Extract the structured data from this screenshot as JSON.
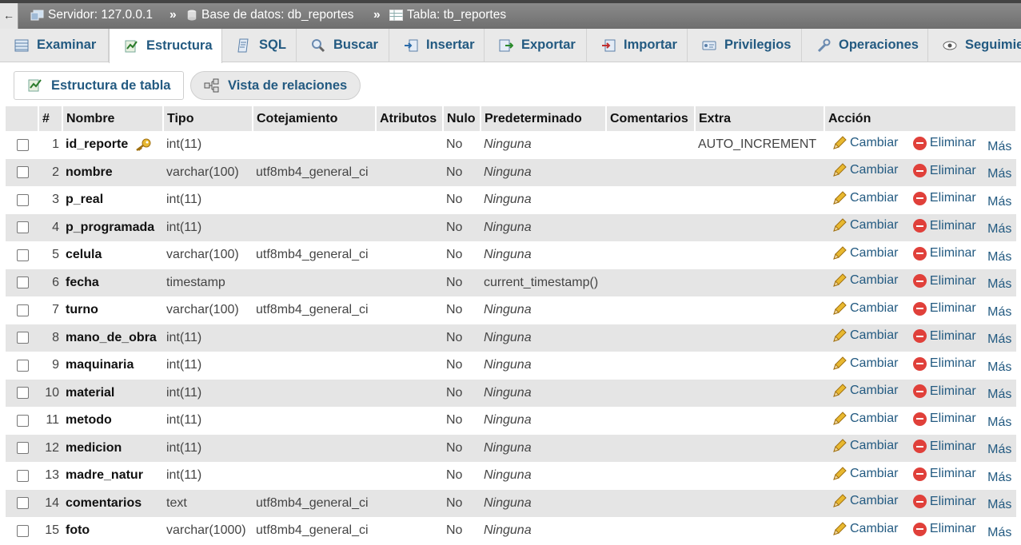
{
  "breadcrumb": {
    "back": "←",
    "server": "Servidor: 127.0.0.1",
    "sep1": "»",
    "database": "Base de datos: db_reportes",
    "sep2": "»",
    "table": "Tabla: tb_reportes"
  },
  "tabs": [
    {
      "label": "Examinar",
      "icon": "browse-icon"
    },
    {
      "label": "Estructura",
      "icon": "structure-icon",
      "active": true
    },
    {
      "label": "SQL",
      "icon": "sql-icon"
    },
    {
      "label": "Buscar",
      "icon": "search-icon"
    },
    {
      "label": "Insertar",
      "icon": "insert-icon"
    },
    {
      "label": "Exportar",
      "icon": "export-icon"
    },
    {
      "label": "Importar",
      "icon": "import-icon"
    },
    {
      "label": "Privilegios",
      "icon": "privileges-icon"
    },
    {
      "label": "Operaciones",
      "icon": "wrench-icon"
    },
    {
      "label": "Seguimie",
      "icon": "eye-icon"
    }
  ],
  "subnav": {
    "structure_label": "Estructura de tabla",
    "relations_label": "Vista de relaciones"
  },
  "table": {
    "headers": [
      "#",
      "Nombre",
      "Tipo",
      "Cotejamiento",
      "Atributos",
      "Nulo",
      "Predeterminado",
      "Comentarios",
      "Extra",
      "Acción"
    ],
    "actions": {
      "change": "Cambiar",
      "drop": "Eliminar",
      "more": "Más"
    },
    "rows": [
      {
        "n": "1",
        "name": "id_reporte",
        "type": "int(11)",
        "collation": "",
        "attributes": "",
        "null": "No",
        "default": "Ninguna",
        "comments": "",
        "extra": "AUTO_INCREMENT",
        "primary": true
      },
      {
        "n": "2",
        "name": "nombre",
        "type": "varchar(100)",
        "collation": "utf8mb4_general_ci",
        "attributes": "",
        "null": "No",
        "default": "Ninguna",
        "comments": "",
        "extra": ""
      },
      {
        "n": "3",
        "name": "p_real",
        "type": "int(11)",
        "collation": "",
        "attributes": "",
        "null": "No",
        "default": "Ninguna",
        "comments": "",
        "extra": ""
      },
      {
        "n": "4",
        "name": "p_programada",
        "type": "int(11)",
        "collation": "",
        "attributes": "",
        "null": "No",
        "default": "Ninguna",
        "comments": "",
        "extra": ""
      },
      {
        "n": "5",
        "name": "celula",
        "type": "varchar(100)",
        "collation": "utf8mb4_general_ci",
        "attributes": "",
        "null": "No",
        "default": "Ninguna",
        "comments": "",
        "extra": ""
      },
      {
        "n": "6",
        "name": "fecha",
        "type": "timestamp",
        "collation": "",
        "attributes": "",
        "null": "No",
        "default": "current_timestamp()",
        "comments": "",
        "extra": "",
        "default_plain": true
      },
      {
        "n": "7",
        "name": "turno",
        "type": "varchar(100)",
        "collation": "utf8mb4_general_ci",
        "attributes": "",
        "null": "No",
        "default": "Ninguna",
        "comments": "",
        "extra": ""
      },
      {
        "n": "8",
        "name": "mano_de_obra",
        "type": "int(11)",
        "collation": "",
        "attributes": "",
        "null": "No",
        "default": "Ninguna",
        "comments": "",
        "extra": ""
      },
      {
        "n": "9",
        "name": "maquinaria",
        "type": "int(11)",
        "collation": "",
        "attributes": "",
        "null": "No",
        "default": "Ninguna",
        "comments": "",
        "extra": ""
      },
      {
        "n": "10",
        "name": "material",
        "type": "int(11)",
        "collation": "",
        "attributes": "",
        "null": "No",
        "default": "Ninguna",
        "comments": "",
        "extra": ""
      },
      {
        "n": "11",
        "name": "metodo",
        "type": "int(11)",
        "collation": "",
        "attributes": "",
        "null": "No",
        "default": "Ninguna",
        "comments": "",
        "extra": ""
      },
      {
        "n": "12",
        "name": "medicion",
        "type": "int(11)",
        "collation": "",
        "attributes": "",
        "null": "No",
        "default": "Ninguna",
        "comments": "",
        "extra": ""
      },
      {
        "n": "13",
        "name": "madre_natur",
        "type": "int(11)",
        "collation": "",
        "attributes": "",
        "null": "No",
        "default": "Ninguna",
        "comments": "",
        "extra": ""
      },
      {
        "n": "14",
        "name": "comentarios",
        "type": "text",
        "collation": "utf8mb4_general_ci",
        "attributes": "",
        "null": "No",
        "default": "Ninguna",
        "comments": "",
        "extra": ""
      },
      {
        "n": "15",
        "name": "foto",
        "type": "varchar(1000)",
        "collation": "utf8mb4_general_ci",
        "attributes": "",
        "null": "No",
        "default": "Ninguna",
        "comments": "",
        "extra": ""
      }
    ]
  },
  "colors": {
    "link": "#235a81",
    "delete": "#e0403a",
    "key": "#e8b830",
    "pencil": "#d9a520"
  }
}
